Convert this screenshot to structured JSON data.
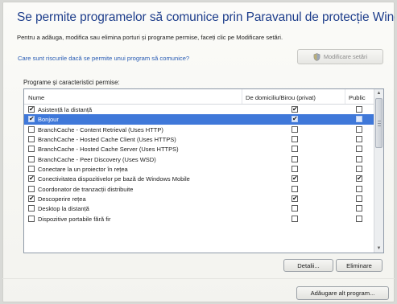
{
  "window": {
    "title": "Se permite programelor să comunice prin Paravanul de protecție Windows",
    "description": "Pentru a adăuga, modifica sau elimina porturi și programe permise, faceți clic pe Modificare setări.",
    "risk_link": "Care sunt riscurile dacă se permite unui program să comunice?",
    "modify_settings_button": "Modificare setări"
  },
  "programs": {
    "group_label": "Programe și caracteristici permise:",
    "columns": {
      "name": "Nume",
      "home": "De domiciliu/Birou (privat)",
      "public": "Public"
    },
    "rows": [
      {
        "label": "Asistență la distanță",
        "name_checked": true,
        "home": true,
        "public": false,
        "selected": false
      },
      {
        "label": "Bonjour",
        "name_checked": true,
        "home": true,
        "public": false,
        "selected": true
      },
      {
        "label": "BranchCache - Content Retrieval (Uses HTTP)",
        "name_checked": false,
        "home": false,
        "public": false,
        "selected": false
      },
      {
        "label": "BranchCache - Hosted Cache Client (Uses HTTPS)",
        "name_checked": false,
        "home": false,
        "public": false,
        "selected": false
      },
      {
        "label": "BranchCache - Hosted Cache Server (Uses HTTPS)",
        "name_checked": false,
        "home": false,
        "public": false,
        "selected": false
      },
      {
        "label": "BranchCache - Peer Discovery (Uses WSD)",
        "name_checked": false,
        "home": false,
        "public": false,
        "selected": false
      },
      {
        "label": "Conectare la un proiector în rețea",
        "name_checked": false,
        "home": false,
        "public": false,
        "selected": false
      },
      {
        "label": "Conectivitatea dispozitivelor pe bază de Windows Mobile",
        "name_checked": true,
        "home": true,
        "public": true,
        "selected": false
      },
      {
        "label": "Coordonator de tranzacții distribuite",
        "name_checked": false,
        "home": false,
        "public": false,
        "selected": false
      },
      {
        "label": "Descoperire rețea",
        "name_checked": true,
        "home": true,
        "public": false,
        "selected": false
      },
      {
        "label": "Desktop la distanță",
        "name_checked": false,
        "home": false,
        "public": false,
        "selected": false
      },
      {
        "label": "Dispozitive portabile fără fir",
        "name_checked": false,
        "home": false,
        "public": false,
        "selected": false
      }
    ],
    "check_glyph": "✔"
  },
  "buttons": {
    "details": "Detalii...",
    "remove": "Eliminare",
    "add_program": "Adăugare alt program..."
  },
  "colors": {
    "title": "#1f3f8c",
    "link": "#2a5db4",
    "selection": "#3f78d9"
  }
}
